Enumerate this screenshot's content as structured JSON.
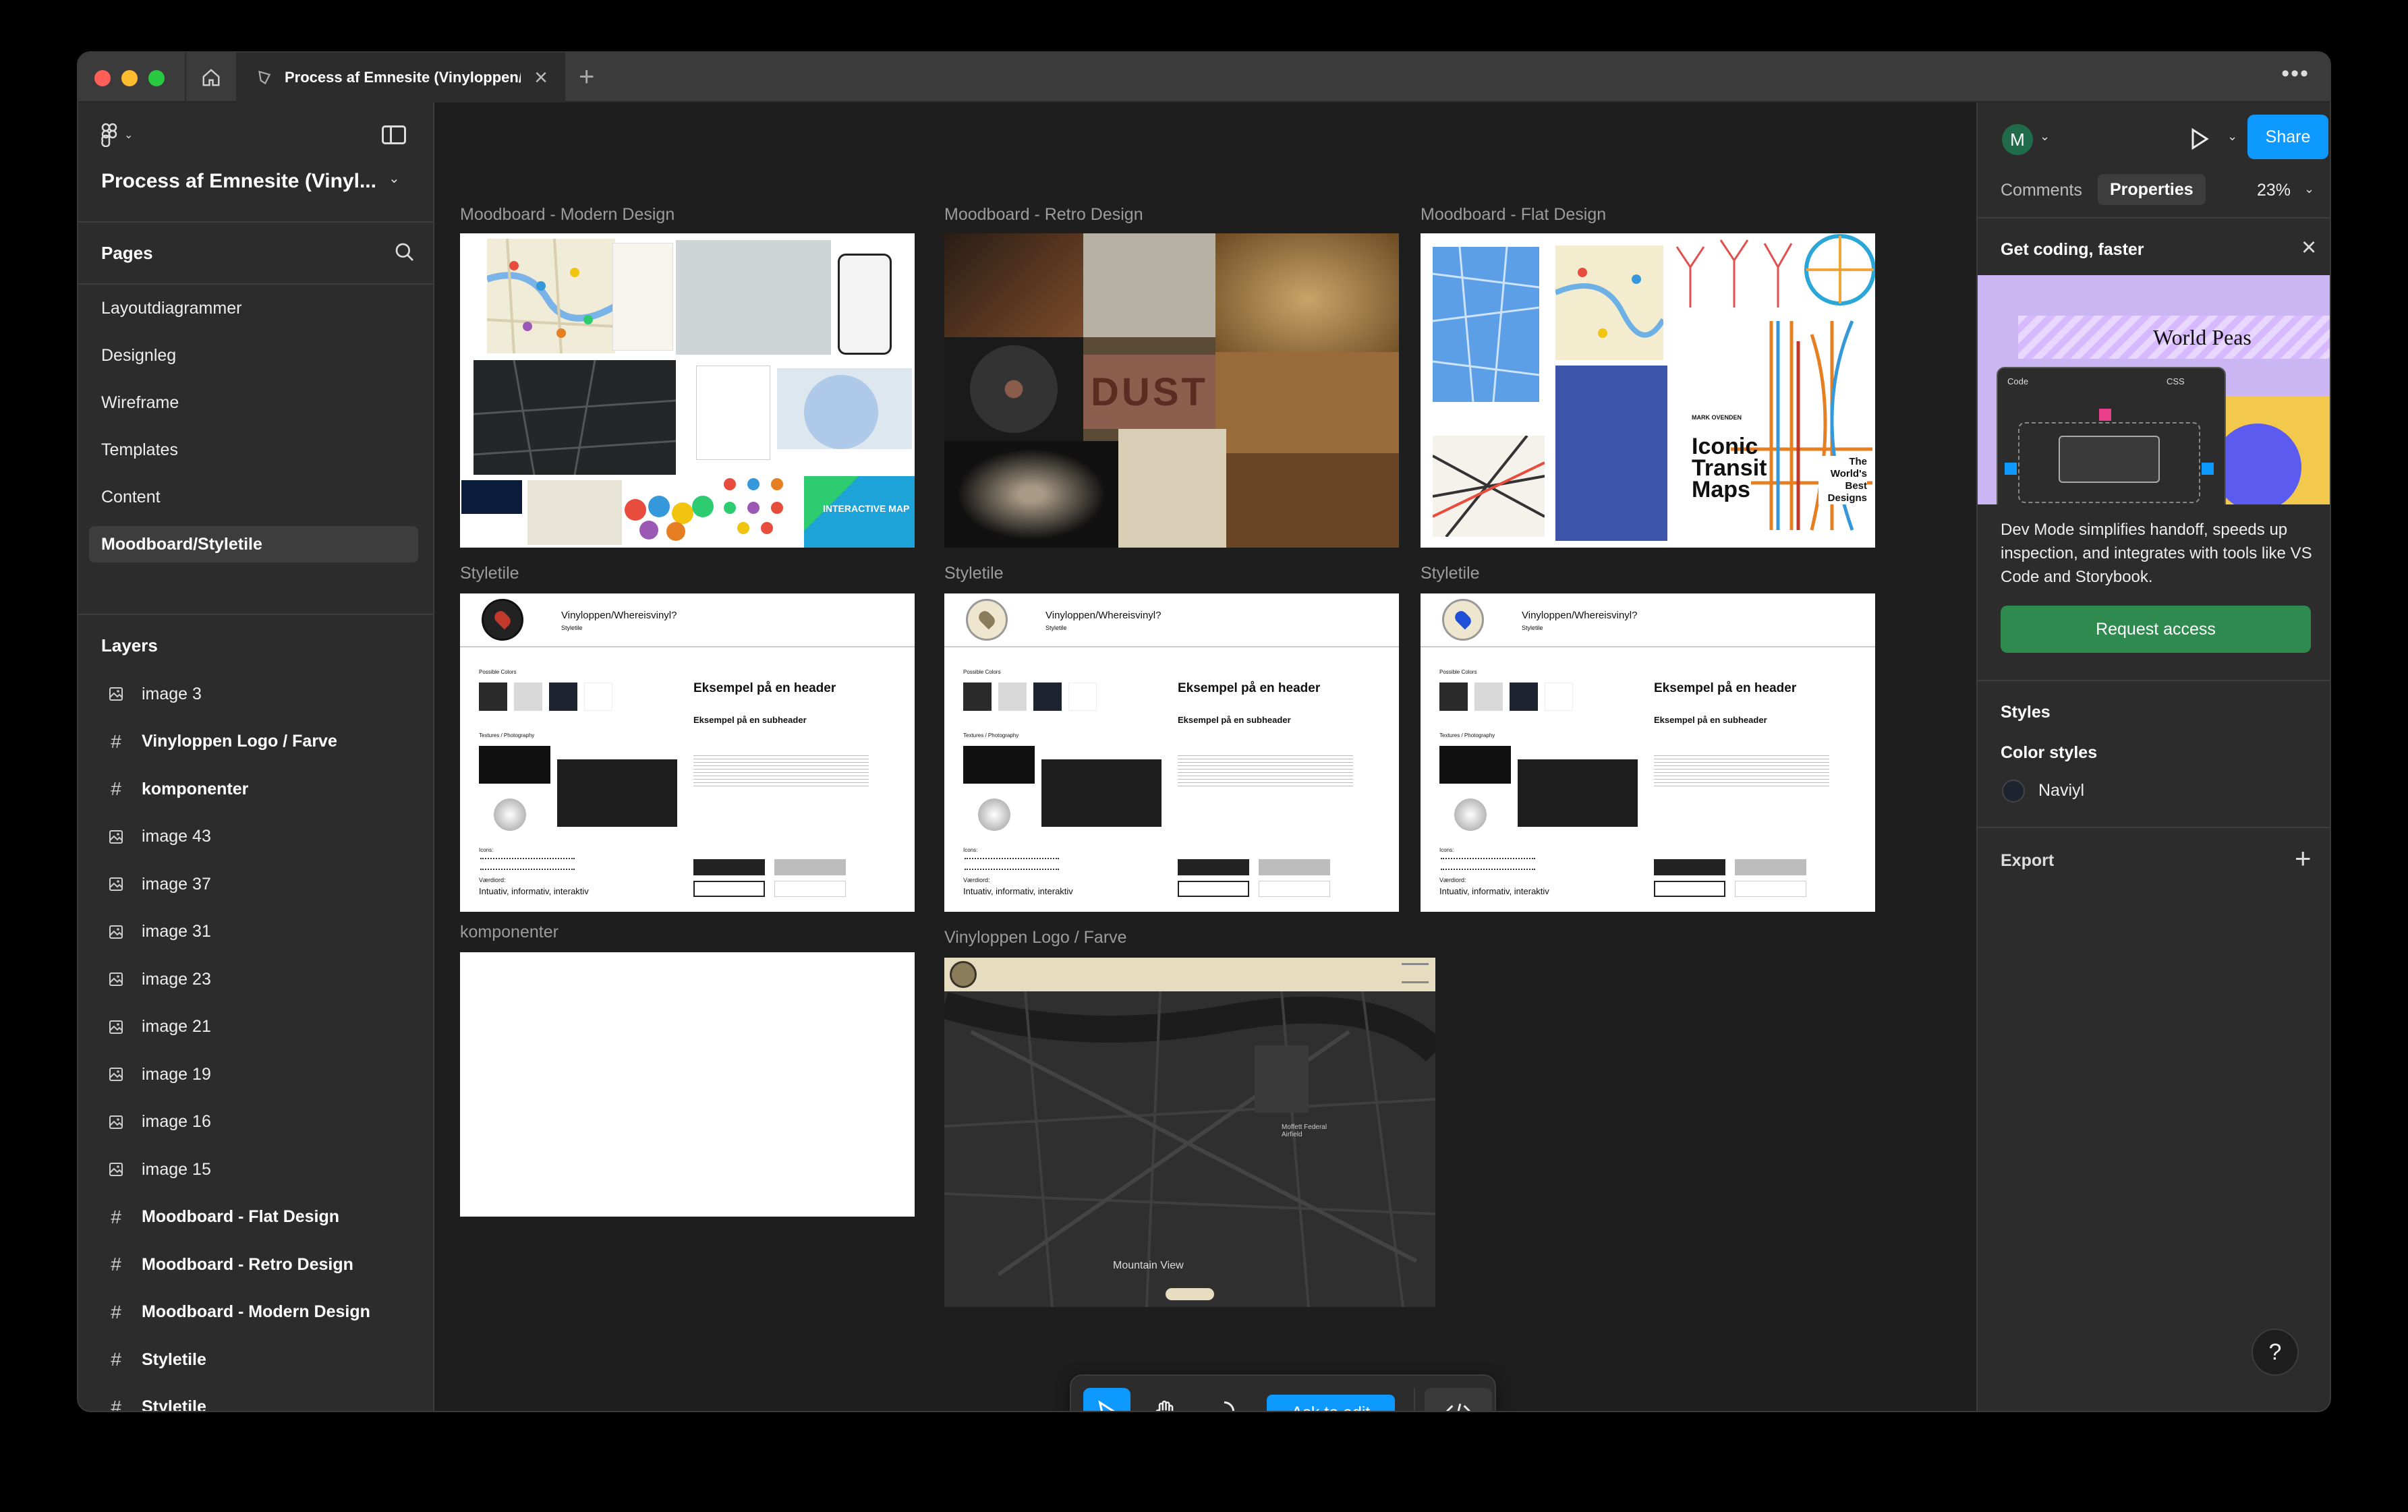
{
  "window": {
    "tab_title": "Process af Emnesite (Vinyloppen/",
    "new_tab_label": "+",
    "more_label": "•••"
  },
  "left_panel": {
    "file_name": "Process af Emnesite (Vinyl...",
    "pages_header": "Pages",
    "pages": [
      {
        "label": "Layoutdiagrammer",
        "selected": false
      },
      {
        "label": "Designleg",
        "selected": false
      },
      {
        "label": "Wireframe",
        "selected": false
      },
      {
        "label": "Templates",
        "selected": false
      },
      {
        "label": "Content",
        "selected": false
      },
      {
        "label": "Moodboard/Styletile",
        "selected": true
      }
    ],
    "layers_header": "Layers",
    "layers": [
      {
        "label": "image 3",
        "type": "image"
      },
      {
        "label": "Vinyloppen Logo / Farve",
        "type": "frame"
      },
      {
        "label": "komponenter",
        "type": "frame"
      },
      {
        "label": "image 43",
        "type": "image"
      },
      {
        "label": "image 37",
        "type": "image"
      },
      {
        "label": "image 31",
        "type": "image"
      },
      {
        "label": "image 23",
        "type": "image"
      },
      {
        "label": "image 21",
        "type": "image"
      },
      {
        "label": "image 19",
        "type": "image"
      },
      {
        "label": "image 16",
        "type": "image"
      },
      {
        "label": "image 15",
        "type": "image"
      },
      {
        "label": "Moodboard - Flat Design",
        "type": "frame"
      },
      {
        "label": "Moodboard - Retro Design",
        "type": "frame"
      },
      {
        "label": "Moodboard - Modern Design",
        "type": "frame"
      },
      {
        "label": "Styletile",
        "type": "frame"
      },
      {
        "label": "Styletile",
        "type": "frame"
      },
      {
        "label": "Styletile",
        "type": "frame"
      }
    ]
  },
  "canvas": {
    "frames": {
      "modern": "Moodboard - Modern Design",
      "retro": "Moodboard - Retro Design",
      "flat": "Moodboard - Flat Design",
      "styletile_1": "Styletile",
      "styletile_2": "Styletile",
      "styletile_3": "Styletile",
      "komponenter": "komponenter",
      "logo": "Vinyloppen Logo / Farve"
    },
    "styletile": {
      "brand": "Vinyloppen/Whereisvinyl?",
      "sub": "Styletile",
      "header_example": "Eksempel på en header",
      "subheader_example": "Eksempel på en subheader",
      "values_label": "Værdiord:",
      "values": "Intuativ, informativ, interaktiv",
      "colors_label": "Possible Colors",
      "textures_label": "Textures / Photography",
      "icons_label": "Icons:"
    },
    "modern_board": {
      "interactive_map": "INTERACTIVE MAP"
    },
    "retro_board": {
      "dust": "DUST"
    },
    "flat_board": {
      "iconic": "Iconic Transit Maps",
      "worlds_best": "The World's Best Designs",
      "author": "MARK OVENDEN"
    },
    "map": {
      "city": "Mountain View",
      "label1": "Moffett Federal Airfield"
    }
  },
  "right_panel": {
    "avatar_letter": "M",
    "share_label": "Share",
    "tab_comments": "Comments",
    "tab_properties": "Properties",
    "zoom": "23%",
    "promo_title": "Get coding, faster",
    "promo_text": "Dev Mode simplifies handoff, speeds up inspection, and integrates with tools like VS Code and Storybook.",
    "promo_image_text": "World Peas",
    "promo_code_label": "Code",
    "promo_css_label": "CSS",
    "request_label": "Request access",
    "styles_header": "Styles",
    "color_styles_header": "Color styles",
    "color_style_name": "Naviyl",
    "export_header": "Export",
    "help_label": "?"
  },
  "toolbar": {
    "ask_edit_label": "Ask to edit"
  },
  "colors": {
    "accent": "#0d99ff",
    "request_btn": "#2f8a4f",
    "canvas_bg": "#1e1e1e",
    "panel_bg": "#2c2c2c"
  }
}
